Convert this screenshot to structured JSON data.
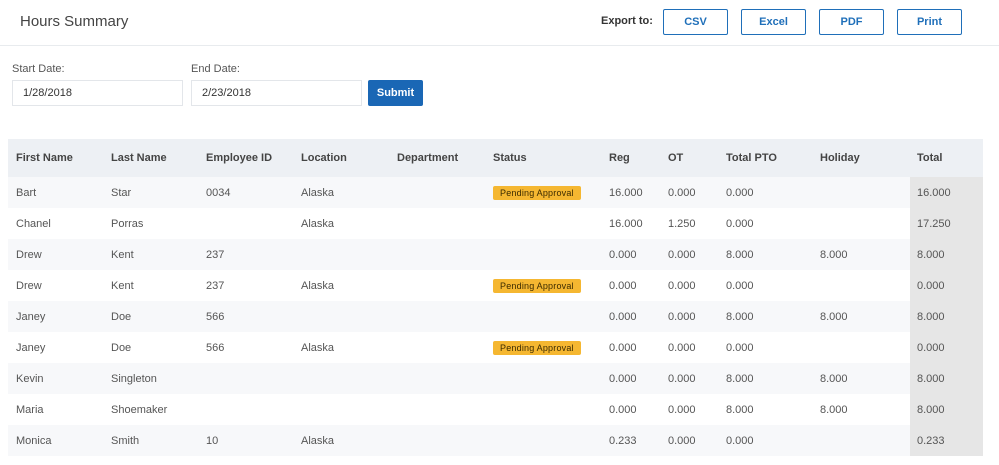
{
  "header": {
    "title": "Hours Summary",
    "export_label": "Export to:",
    "export_buttons": [
      "CSV",
      "Excel",
      "PDF",
      "Print"
    ]
  },
  "filters": {
    "start_label": "Start Date:",
    "start_value": "1/28/2018",
    "end_label": "End Date:",
    "end_value": "2/23/2018",
    "submit_label": "Submit"
  },
  "colors": {
    "accent": "#1a67b5",
    "badge": "#f5b731",
    "header_bg": "#edf0f4"
  },
  "table": {
    "columns": [
      "First Name",
      "Last Name",
      "Employee ID",
      "Location",
      "Department",
      "Status",
      "Reg",
      "OT",
      "Total PTO",
      "Holiday",
      "Total"
    ],
    "rows": [
      [
        "Bart",
        "Star",
        "0034",
        "Alaska",
        "",
        "Pending Approval",
        "16.000",
        "0.000",
        "0.000",
        "",
        "16.000"
      ],
      [
        "Chanel",
        "Porras",
        "",
        "Alaska",
        "",
        "",
        "16.000",
        "1.250",
        "0.000",
        "",
        "17.250"
      ],
      [
        "Drew",
        "Kent",
        "237",
        "",
        "",
        "",
        "0.000",
        "0.000",
        "8.000",
        "8.000",
        "8.000"
      ],
      [
        "Drew",
        "Kent",
        "237",
        "Alaska",
        "",
        "Pending Approval",
        "0.000",
        "0.000",
        "0.000",
        "",
        "0.000"
      ],
      [
        "Janey",
        "Doe",
        "566",
        "",
        "",
        "",
        "0.000",
        "0.000",
        "8.000",
        "8.000",
        "8.000"
      ],
      [
        "Janey",
        "Doe",
        "566",
        "Alaska",
        "",
        "Pending Approval",
        "0.000",
        "0.000",
        "0.000",
        "",
        "0.000"
      ],
      [
        "Kevin",
        "Singleton",
        "",
        "",
        "",
        "",
        "0.000",
        "0.000",
        "8.000",
        "8.000",
        "8.000"
      ],
      [
        "Maria",
        "Shoemaker",
        "",
        "",
        "",
        "",
        "0.000",
        "0.000",
        "8.000",
        "8.000",
        "8.000"
      ],
      [
        "Monica",
        "Smith",
        "10",
        "Alaska",
        "",
        "",
        "0.233",
        "0.000",
        "0.000",
        "",
        "0.233"
      ]
    ]
  }
}
